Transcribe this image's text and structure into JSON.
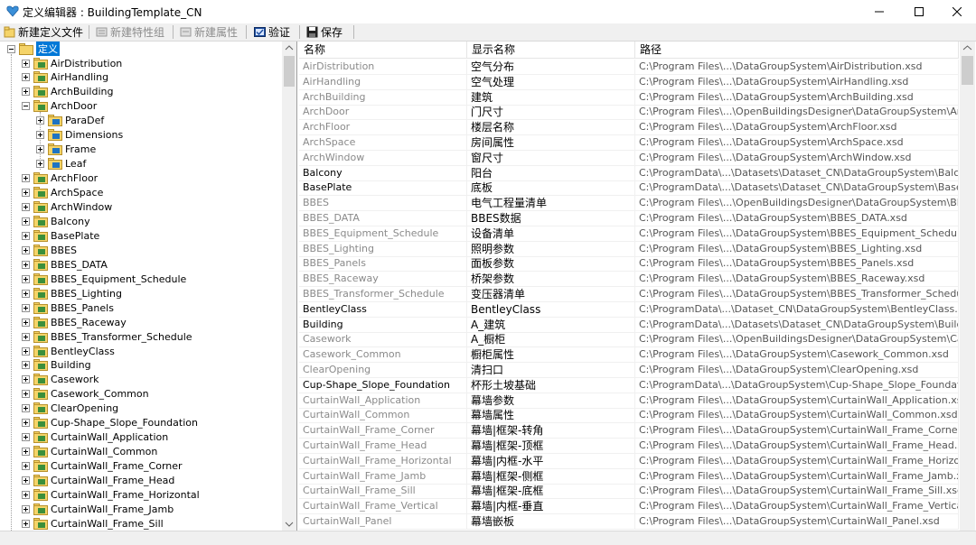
{
  "window": {
    "title": "定义编辑器 : BuildingTemplate_CN"
  },
  "toolbar": {
    "new_def_file": "新建定义文件",
    "new_feature_group": "新建特性组",
    "new_property": "新建属性",
    "validate": "验证",
    "save": "保存"
  },
  "tree": {
    "root": "定义",
    "items": [
      {
        "label": "AirDistribution"
      },
      {
        "label": "AirHandling"
      },
      {
        "label": "ArchBuilding"
      },
      {
        "label": "ArchDoor"
      },
      {
        "label": "ParaDef"
      },
      {
        "label": "Dimensions"
      },
      {
        "label": "Frame"
      },
      {
        "label": "Leaf"
      },
      {
        "label": "ArchFloor"
      },
      {
        "label": "ArchSpace"
      },
      {
        "label": "ArchWindow"
      },
      {
        "label": "Balcony"
      },
      {
        "label": "BasePlate"
      },
      {
        "label": "BBES"
      },
      {
        "label": "BBES_DATA"
      },
      {
        "label": "BBES_Equipment_Schedule"
      },
      {
        "label": "BBES_Lighting"
      },
      {
        "label": "BBES_Panels"
      },
      {
        "label": "BBES_Raceway"
      },
      {
        "label": "BBES_Transformer_Schedule"
      },
      {
        "label": "BentleyClass"
      },
      {
        "label": "Building"
      },
      {
        "label": "Casework"
      },
      {
        "label": "Casework_Common"
      },
      {
        "label": "ClearOpening"
      },
      {
        "label": "Cup-Shape_Slope_Foundation"
      },
      {
        "label": "CurtainWall_Application"
      },
      {
        "label": "CurtainWall_Common"
      },
      {
        "label": "CurtainWall_Frame_Corner"
      },
      {
        "label": "CurtainWall_Frame_Head"
      },
      {
        "label": "CurtainWall_Frame_Horizontal"
      },
      {
        "label": "CurtainWall_Frame_Jamb"
      },
      {
        "label": "CurtainWall_Frame_Sill"
      }
    ]
  },
  "list": {
    "headers": [
      "名称",
      "显示名称",
      "路径"
    ],
    "rows": [
      {
        "name": "AirDistribution",
        "display": "空气分布",
        "path": "C:\\Program Files\\...\\DataGroupSystem\\AirDistribution.xsd"
      },
      {
        "name": "AirHandling",
        "display": "空气处理",
        "path": "C:\\Program Files\\...\\DataGroupSystem\\AirHandling.xsd"
      },
      {
        "name": "ArchBuilding",
        "display": "建筑",
        "path": "C:\\Program Files\\...\\DataGroupSystem\\ArchBuilding.xsd"
      },
      {
        "name": "ArchDoor",
        "display": "门尺寸",
        "path": "C:\\Program Files\\...\\OpenBuildingsDesigner\\DataGroupSystem\\ArchDoor.xsd"
      },
      {
        "name": "ArchFloor",
        "display": "楼层名称",
        "path": "C:\\Program Files\\...\\DataGroupSystem\\ArchFloor.xsd"
      },
      {
        "name": "ArchSpace",
        "display": "房间属性",
        "path": "C:\\Program Files\\...\\DataGroupSystem\\ArchSpace.xsd"
      },
      {
        "name": "ArchWindow",
        "display": "窗尺寸",
        "path": "C:\\Program Files\\...\\DataGroupSystem\\ArchWindow.xsd"
      },
      {
        "name": "Balcony",
        "display": "阳台",
        "path": "C:\\ProgramData\\...\\Datasets\\Dataset_CN\\DataGroupSystem\\Balcony.xsd"
      },
      {
        "name": "BasePlate",
        "display": "底板",
        "path": "C:\\ProgramData\\...\\Datasets\\Dataset_CN\\DataGroupSystem\\BasePlate.xsd"
      },
      {
        "name": "BBES",
        "display": "电气工程量清单",
        "path": "C:\\Program Files\\...\\OpenBuildingsDesigner\\DataGroupSystem\\BBES.xsd"
      },
      {
        "name": "BBES_DATA",
        "display": "BBES数据",
        "path": "C:\\Program Files\\...\\DataGroupSystem\\BBES_DATA.xsd"
      },
      {
        "name": "BBES_Equipment_Schedule",
        "display": "设备清单",
        "path": "C:\\Program Files\\...\\DataGroupSystem\\BBES_Equipment_Schedule.xsd"
      },
      {
        "name": "BBES_Lighting",
        "display": "照明参数",
        "path": "C:\\Program Files\\...\\DataGroupSystem\\BBES_Lighting.xsd"
      },
      {
        "name": "BBES_Panels",
        "display": "面板参数",
        "path": "C:\\Program Files\\...\\DataGroupSystem\\BBES_Panels.xsd"
      },
      {
        "name": "BBES_Raceway",
        "display": "桥架参数",
        "path": "C:\\Program Files\\...\\DataGroupSystem\\BBES_Raceway.xsd"
      },
      {
        "name": "BBES_Transformer_Schedule",
        "display": "变压器清单",
        "path": "C:\\Program Files\\...\\DataGroupSystem\\BBES_Transformer_Schedule.xsd"
      },
      {
        "name": "BentleyClass",
        "display": "BentleyClass",
        "path": "C:\\ProgramData\\...\\Dataset_CN\\DataGroupSystem\\BentleyClass.xsd"
      },
      {
        "name": "Building",
        "display": "A_建筑",
        "path": "C:\\ProgramData\\...\\Datasets\\Dataset_CN\\DataGroupSystem\\Building.xsd"
      },
      {
        "name": "Casework",
        "display": "A_橱柜",
        "path": "C:\\Program Files\\...\\OpenBuildingsDesigner\\DataGroupSystem\\Casework.xsd"
      },
      {
        "name": "Casework_Common",
        "display": "橱柜属性",
        "path": "C:\\Program Files\\...\\DataGroupSystem\\Casework_Common.xsd"
      },
      {
        "name": "ClearOpening",
        "display": "清扫口",
        "path": "C:\\Program Files\\...\\DataGroupSystem\\ClearOpening.xsd"
      },
      {
        "name": "Cup-Shape_Slope_Foundation",
        "display": "杯形土坡基础",
        "path": "C:\\ProgramData\\...\\DataGroupSystem\\Cup-Shape_Slope_Foundation.xsd"
      },
      {
        "name": "CurtainWall_Application",
        "display": "幕墙参数",
        "path": "C:\\Program Files\\...\\DataGroupSystem\\CurtainWall_Application.xsd"
      },
      {
        "name": "CurtainWall_Common",
        "display": "幕墙属性",
        "path": "C:\\Program Files\\...\\DataGroupSystem\\CurtainWall_Common.xsd"
      },
      {
        "name": "CurtainWall_Frame_Corner",
        "display": "幕墙|框架-转角",
        "path": "C:\\Program Files\\...\\DataGroupSystem\\CurtainWall_Frame_Corner.xsd"
      },
      {
        "name": "CurtainWall_Frame_Head",
        "display": "幕墙|框架-顶框",
        "path": "C:\\Program Files\\...\\DataGroupSystem\\CurtainWall_Frame_Head.xsd"
      },
      {
        "name": "CurtainWall_Frame_Horizontal",
        "display": "幕墙|内框-水平",
        "path": "C:\\Program Files\\...\\DataGroupSystem\\CurtainWall_Frame_Horizontal.xsd"
      },
      {
        "name": "CurtainWall_Frame_Jamb",
        "display": "幕墙|框架-侧框",
        "path": "C:\\Program Files\\...\\DataGroupSystem\\CurtainWall_Frame_Jamb.xsd"
      },
      {
        "name": "CurtainWall_Frame_Sill",
        "display": "幕墙|框架-底框",
        "path": "C:\\Program Files\\...\\DataGroupSystem\\CurtainWall_Frame_Sill.xsd"
      },
      {
        "name": "CurtainWall_Frame_Vertical",
        "display": "幕墙|内框-垂直",
        "path": "C:\\Program Files\\...\\DataGroupSystem\\CurtainWall_Frame_Vertical.xsd"
      },
      {
        "name": "CurtainWall_Panel",
        "display": "幕墙嵌板",
        "path": "C:\\Program Files\\...\\DataGroupSystem\\CurtainWall_Panel.xsd"
      }
    ]
  },
  "colors": {
    "selection": "#0078d7",
    "folder": "#f5d469"
  }
}
